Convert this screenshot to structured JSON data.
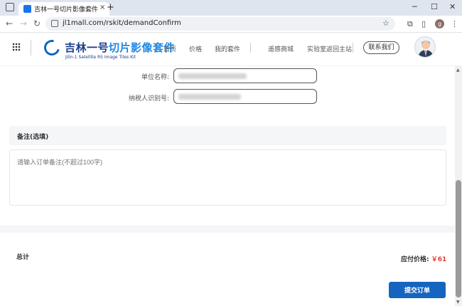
{
  "browser": {
    "tab_title": "吉林一号切片影像套件",
    "tab_close": "×",
    "new_tab": "+",
    "url": "jl1mall.com/rskit/demandConfirm",
    "window_controls": [
      "─",
      "☐",
      "✕"
    ],
    "profile_initial": "g"
  },
  "header": {
    "logo_main": "吉林一号",
    "logo_highlight": "切片影像套件",
    "logo_sub": "Jilin-1 Satellite RS Image Tiles Kit",
    "nav": [
      "首页",
      "价格",
      "我的套件",
      "遥感商城",
      "实验室返回主站"
    ],
    "contact": "联系我们"
  },
  "form": {
    "company_label": "单位名称:",
    "tax_id_label": "纳税人识别号:"
  },
  "remark": {
    "title": "备注(选填)",
    "placeholder": "请输入订单备注(不超过100字)"
  },
  "summary": {
    "total_label": "总计",
    "payable_label": "应付价格:",
    "payable_value": "￥61",
    "submit": "提交订单"
  },
  "colors": {
    "accent": "#1565c0",
    "price": "#e53935"
  }
}
